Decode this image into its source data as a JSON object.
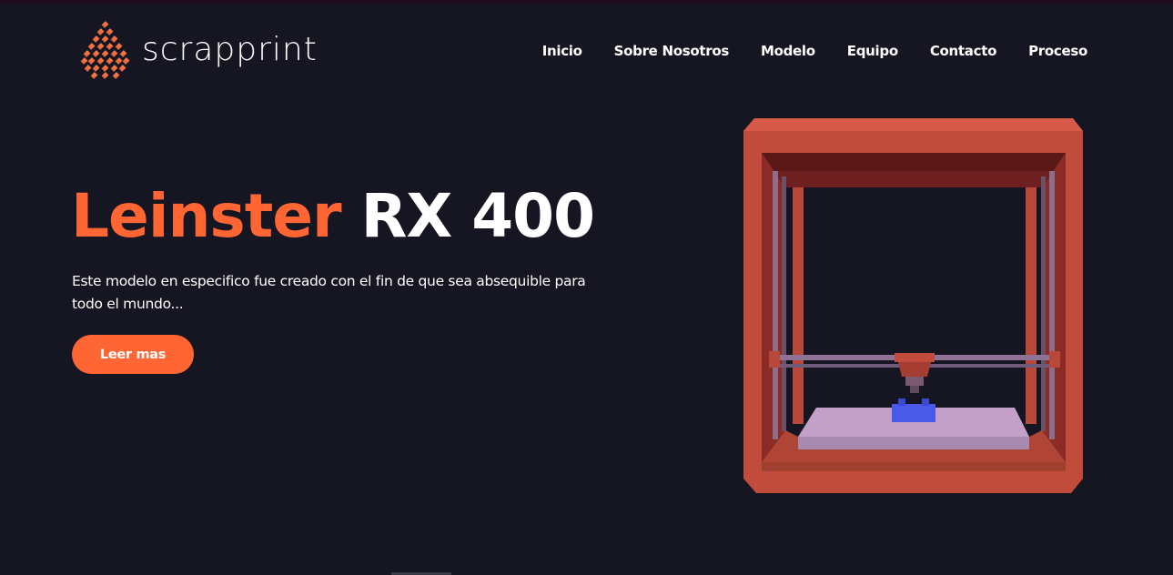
{
  "brand": {
    "name": "scrapprint",
    "logo_icon": "diamond-mesh-icon"
  },
  "nav": {
    "items": [
      {
        "label": "Inicio"
      },
      {
        "label": "Sobre Nosotros"
      },
      {
        "label": "Modelo"
      },
      {
        "label": "Equipo"
      },
      {
        "label": "Contacto"
      },
      {
        "label": "Proceso"
      }
    ]
  },
  "hero": {
    "title_accent": "Leinster",
    "title_rest": "RX 400",
    "description": "Este modelo en especifico fue creado con el fin de que sea absequible para todo el mundo...",
    "cta_label": "Leer mas",
    "image_icon": "3d-printer-render"
  },
  "colors": {
    "background": "#161622",
    "accent": "#ff6633",
    "text": "#ffffff",
    "printer_frame": "#c4503f",
    "printer_block": "#4a5ae8"
  }
}
